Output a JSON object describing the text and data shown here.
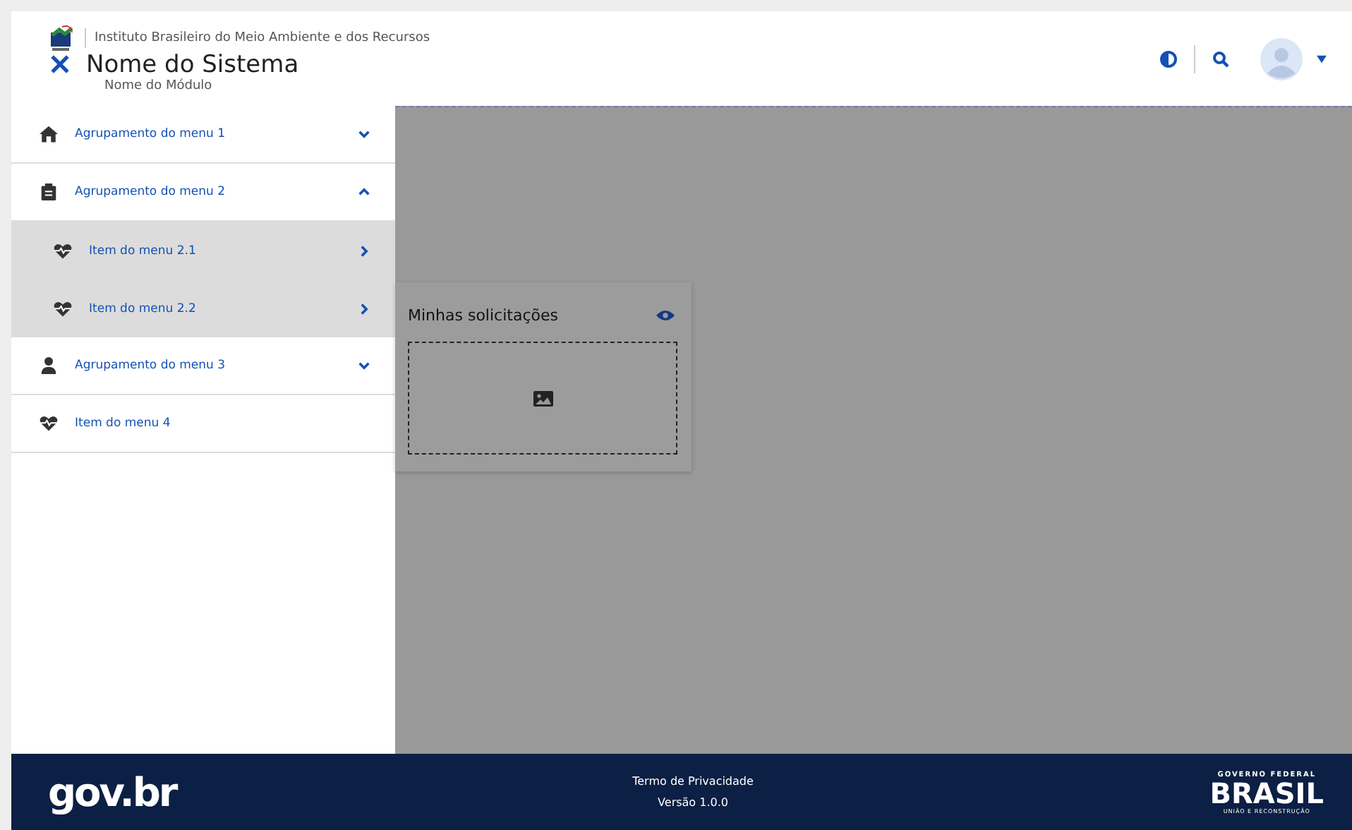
{
  "header": {
    "institution": "Instituto Brasileiro do Meio Ambiente e dos Recursos",
    "system_name": "Nome do Sistema",
    "module_name": "Nome do Módulo"
  },
  "menu": [
    {
      "label": "Agrupamento do menu 1",
      "kind": "group",
      "expanded": false
    },
    {
      "label": "Agrupamento do menu 2",
      "kind": "group",
      "expanded": true,
      "children": [
        {
          "label": "Item do menu 2.1"
        },
        {
          "label": "Item do menu 2.2"
        }
      ]
    },
    {
      "label": "Agrupamento do menu 3",
      "kind": "group",
      "expanded": false
    },
    {
      "label": "Item do menu 4",
      "kind": "item"
    }
  ],
  "card": {
    "title": "Minhas solicitações"
  },
  "footer": {
    "logo": "gov.br",
    "links": [
      "Termo de Privacidade",
      "Versão 1.0.0"
    ],
    "brand_top": "GOVERNO FEDERAL",
    "brand": "BRASIL",
    "brand_sub": "UNIÃO E RECONSTRUÇÃO"
  }
}
